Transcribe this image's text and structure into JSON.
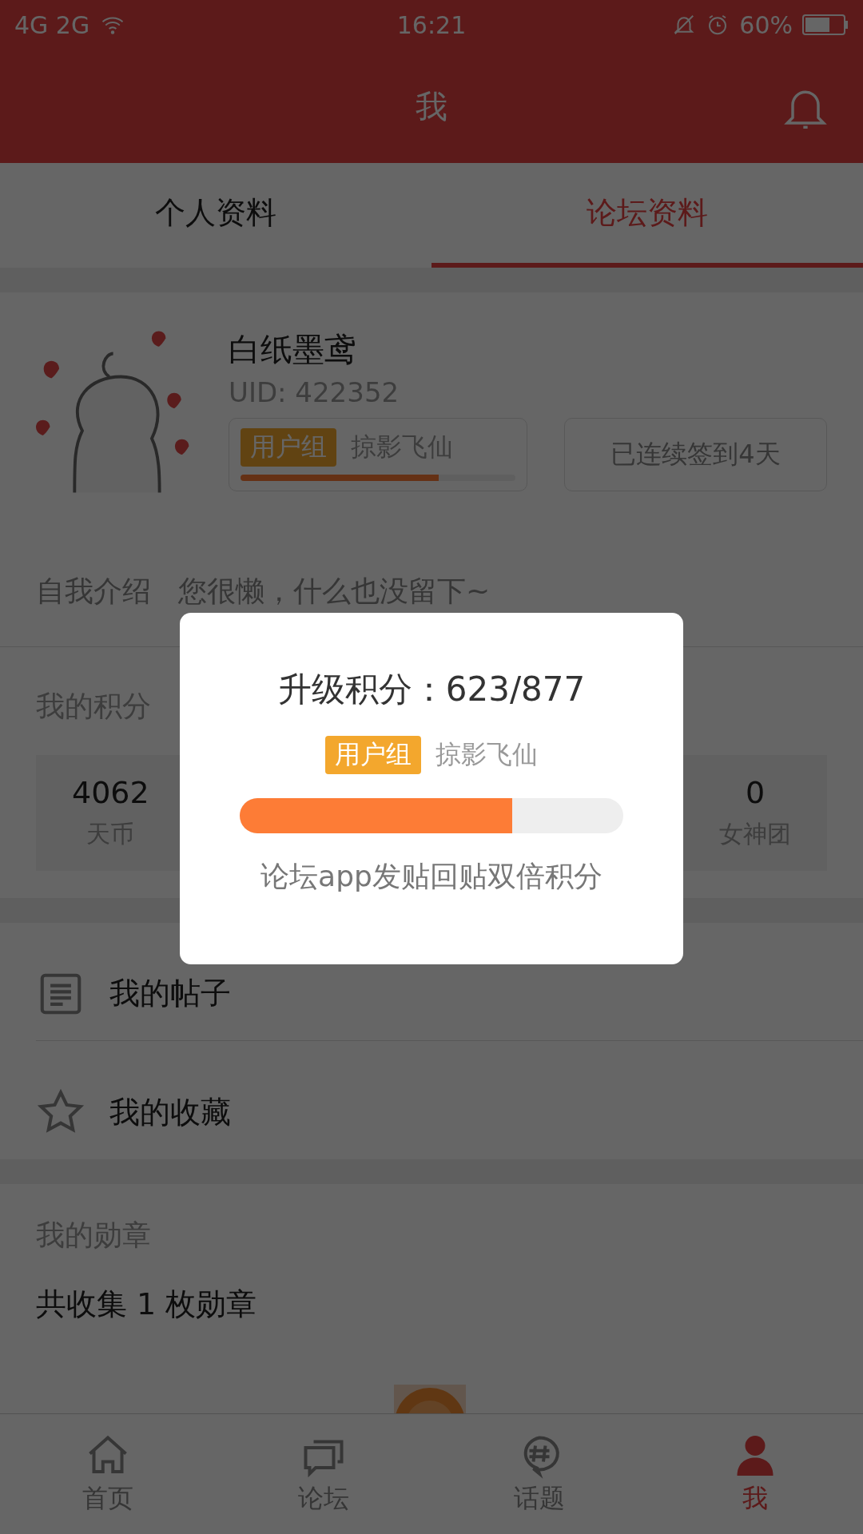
{
  "status_bar": {
    "network": "4G 2G",
    "time": "16:21",
    "battery": "60%"
  },
  "header": {
    "title": "我"
  },
  "tabs": [
    {
      "label": "个人资料",
      "selected": false
    },
    {
      "label": "论坛资料",
      "selected": true
    }
  ],
  "profile": {
    "name": "白纸墨鸢",
    "uid": "UID: 422352",
    "group_tag": "用户组",
    "group_name": "掠影飞仙",
    "level": 0.72,
    "checkin": "已连续签到4天",
    "intro_label": "自我介绍",
    "intro": "您很懒，什么也没留下~"
  },
  "points": {
    "title": "我的积分",
    "stats": [
      {
        "value": "4062",
        "label": "天币"
      },
      {
        "value": "0",
        "label": "女神团"
      }
    ]
  },
  "menu": [
    {
      "label": "我的帖子",
      "kind": "posts"
    },
    {
      "label": "我的收藏",
      "kind": "favorites"
    }
  ],
  "medals": {
    "title": "我的勋章",
    "summary": "共收集 1 枚勋章"
  },
  "bottom_nav": [
    {
      "label": "首页",
      "kind": "home",
      "selected": false
    },
    {
      "label": "论坛",
      "kind": "forum",
      "selected": false
    },
    {
      "label": "话题",
      "kind": "topic",
      "selected": false
    },
    {
      "label": "我",
      "kind": "me",
      "selected": true
    }
  ],
  "dialog": {
    "title": "升级积分：623/877",
    "group_tag": "用户组",
    "group_name": "掠影飞仙",
    "level": 0.71,
    "note": "论坛app发贴回贴双倍积分"
  }
}
